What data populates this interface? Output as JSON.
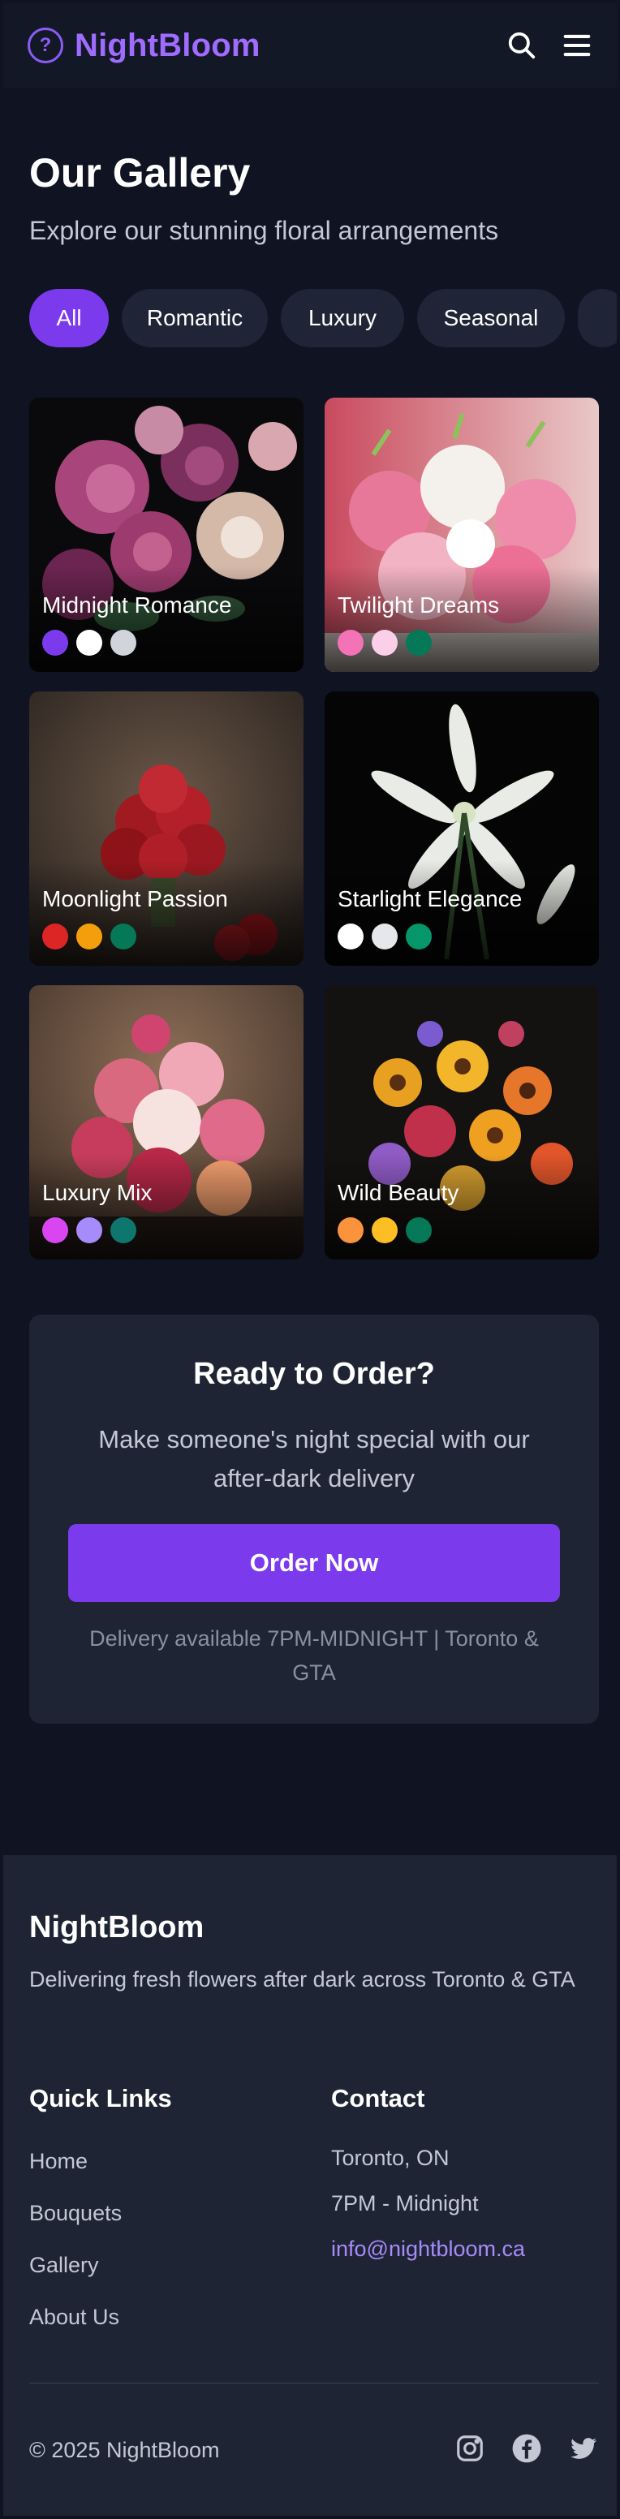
{
  "brand": {
    "name": "NightBloom",
    "logo_icon": "question-circle-icon"
  },
  "header": {
    "search_icon": "search-icon",
    "menu_icon": "hamburger-menu-icon"
  },
  "hero": {
    "title": "Our Gallery",
    "subtitle": "Explore our stunning floral arrangements"
  },
  "filters": [
    {
      "label": "All",
      "active": true
    },
    {
      "label": "Romantic",
      "active": false
    },
    {
      "label": "Luxury",
      "active": false
    },
    {
      "label": "Seasonal",
      "active": false
    }
  ],
  "gallery": [
    {
      "name": "Midnight Romance",
      "colors": [
        "#7c3aed",
        "#ffffff",
        "#d1d5db"
      ]
    },
    {
      "name": "Twilight Dreams",
      "colors": [
        "#f472b6",
        "#fbcfe8",
        "#047857"
      ]
    },
    {
      "name": "Moonlight Passion",
      "colors": [
        "#dc2626",
        "#f59e0b",
        "#047857"
      ]
    },
    {
      "name": "Starlight Elegance",
      "colors": [
        "#ffffff",
        "#e5e7eb",
        "#059669"
      ]
    },
    {
      "name": "Luxury Mix",
      "colors": [
        "#d946ef",
        "#a78bfa",
        "#0f766e"
      ]
    },
    {
      "name": "Wild Beauty",
      "colors": [
        "#fb923c",
        "#fbbf24",
        "#047857"
      ]
    }
  ],
  "cta": {
    "title": "Ready to Order?",
    "text": "Make someone's night special with our after-dark delivery",
    "button": "Order Now",
    "note": "Delivery available 7PM-MIDNIGHT | Toronto & GTA"
  },
  "footer": {
    "brand": "NightBloom",
    "tagline": "Delivering fresh flowers after dark across Toronto & GTA",
    "quick_links_title": "Quick Links",
    "quick_links": [
      "Home",
      "Bouquets",
      "Gallery",
      "About Us"
    ],
    "contact_title": "Contact",
    "contact": {
      "city": "Toronto, ON",
      "hours": "7PM - Midnight",
      "email": "info@nightbloom.ca"
    },
    "copyright": "© 2025 NightBloom",
    "socials": [
      "instagram-icon",
      "facebook-icon",
      "twitter-icon"
    ]
  },
  "colors": {
    "accent": "#7c3aed",
    "brand_text": "#a06bff",
    "background": "#0f1322",
    "surface": "#1e2433"
  }
}
